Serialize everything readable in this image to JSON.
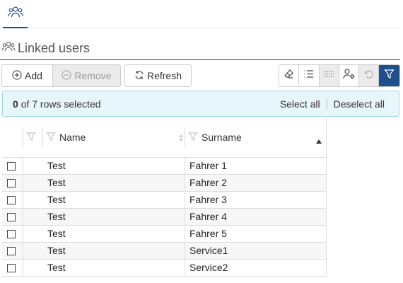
{
  "tabs": [
    {
      "icon": "users-icon",
      "active": true
    }
  ],
  "section": {
    "title": "Linked users",
    "icon": "users-icon"
  },
  "toolbar": {
    "add_label": "Add",
    "remove_label": "Remove",
    "refresh_label": "Refresh",
    "icon_buttons": [
      "eraser-icon",
      "list-icon",
      "row-separator-icon",
      "user-settings-icon",
      "undo-icon",
      "filter-icon"
    ]
  },
  "selection": {
    "count": "0",
    "text": "of 7 rows selected",
    "select_all": "Select all",
    "deselect_all": "Deselect all"
  },
  "table": {
    "columns": [
      {
        "label": "Name",
        "sort": "none"
      },
      {
        "label": "Surname",
        "sort": "ascending"
      }
    ],
    "rows": [
      {
        "name": "Test",
        "surname": "Fahrer 1",
        "checked": false
      },
      {
        "name": "Test",
        "surname": "Fahrer 2",
        "checked": false
      },
      {
        "name": "Test",
        "surname": "Fahrer 3",
        "checked": false
      },
      {
        "name": "Test",
        "surname": "Fahrer 4",
        "checked": false
      },
      {
        "name": "Test",
        "surname": "Fahrer 5",
        "checked": false
      },
      {
        "name": "Test",
        "surname": "Service1",
        "checked": false
      },
      {
        "name": "Test",
        "surname": "Service2",
        "checked": false
      }
    ]
  },
  "colors": {
    "accent": "#1e4f8a",
    "info_bg": "#e6f6fa",
    "info_border": "#9fd8e6"
  }
}
